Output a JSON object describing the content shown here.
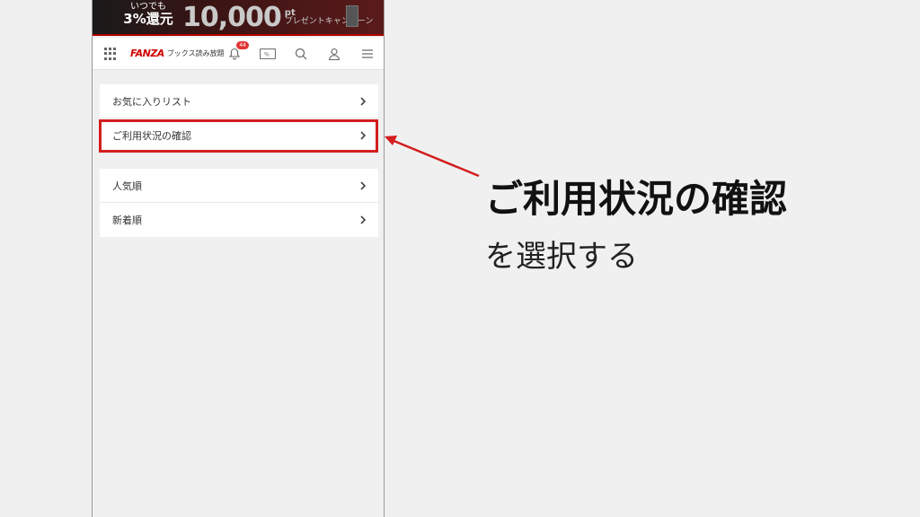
{
  "banner": {
    "line1": "いつでも",
    "line2": "3%還元",
    "amount": "10,000",
    "unit": "pt",
    "campaign": "プレゼントキャンペーン"
  },
  "header": {
    "brand": "FANZA",
    "service": "ブックス読み放題",
    "notification_count": "44",
    "icons": [
      "apps-grid-icon",
      "bell-icon",
      "coupon-icon",
      "search-icon",
      "user-icon",
      "hamburger-menu-icon"
    ]
  },
  "menu_group1": [
    {
      "label": "お気に入りリスト"
    },
    {
      "label": "ご利用状況の確認"
    }
  ],
  "menu_group2": [
    {
      "label": "人気順"
    },
    {
      "label": "新着順"
    }
  ],
  "callout": {
    "title": "ご利用状況の確認",
    "subtitle": "を選択する"
  },
  "colors": {
    "accent": "#d21e1e",
    "brand": "#d00000"
  }
}
